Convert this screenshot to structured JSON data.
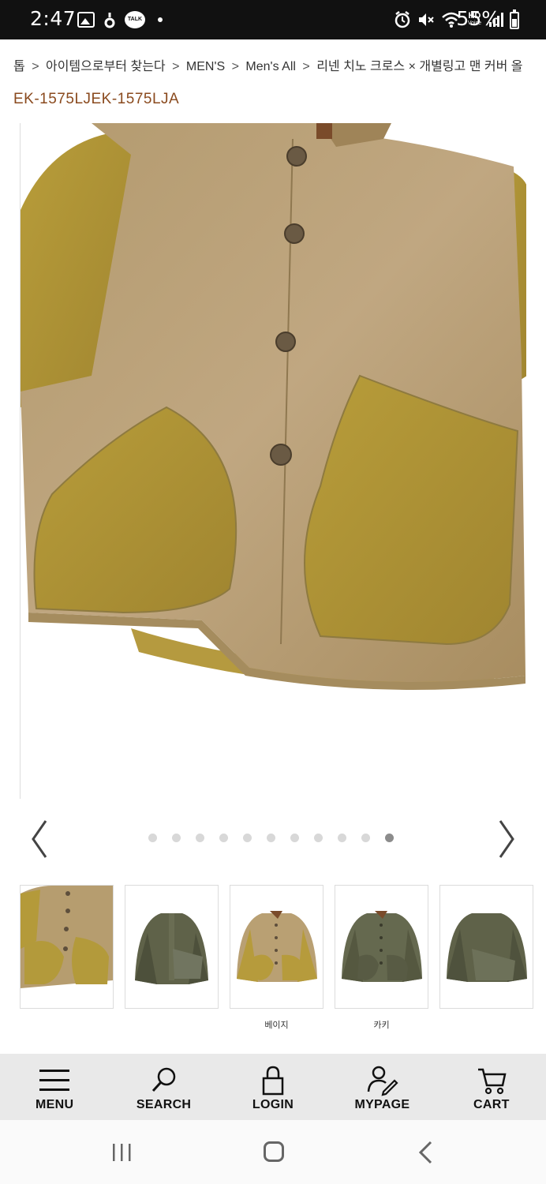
{
  "status_bar": {
    "time": "2:47",
    "battery": "55%",
    "icons": [
      "gallery-icon",
      "drop-icon",
      "kakaotalk-icon",
      "dot-icon",
      "alarm-icon",
      "mute-icon",
      "wifi-icon",
      "hd-voice-icon",
      "signal-icon",
      "battery-icon"
    ],
    "hd_top": "HD",
    "hd_bottom": "Voice",
    "talk": "TALK"
  },
  "breadcrumb": {
    "items": [
      "톱",
      "아이템으로부터 찾는다",
      "MEN'S",
      "Men's All",
      "리넨 치노 크로스 × 개별링고 맨 커버 올"
    ],
    "separator": ">"
  },
  "product": {
    "code": "EK-1575LJEK-1575LJA"
  },
  "gallery": {
    "dot_count": 11,
    "active_index": 10,
    "prev_icon": "chevron-left-icon",
    "next_icon": "chevron-right-icon"
  },
  "thumbnails": [
    {
      "label": "",
      "variant": "beige-closeup"
    },
    {
      "label": "",
      "variant": "khaki-back"
    },
    {
      "label": "베이지",
      "variant": "beige-front"
    },
    {
      "label": "카키",
      "variant": "khaki-front"
    },
    {
      "label": "",
      "variant": "khaki-back-2"
    }
  ],
  "bottom_nav": [
    {
      "label": "MENU",
      "icon": "menu-icon"
    },
    {
      "label": "SEARCH",
      "icon": "search-icon"
    },
    {
      "label": "LOGIN",
      "icon": "lock-icon"
    },
    {
      "label": "MYPAGE",
      "icon": "user-edit-icon"
    },
    {
      "label": "CART",
      "icon": "cart-icon"
    }
  ],
  "colors": {
    "accent_code": "#8a4a1e",
    "jacket_linen": "#b59a6c",
    "jacket_mustard": "#b49a3a",
    "khaki": "#5e6249"
  }
}
